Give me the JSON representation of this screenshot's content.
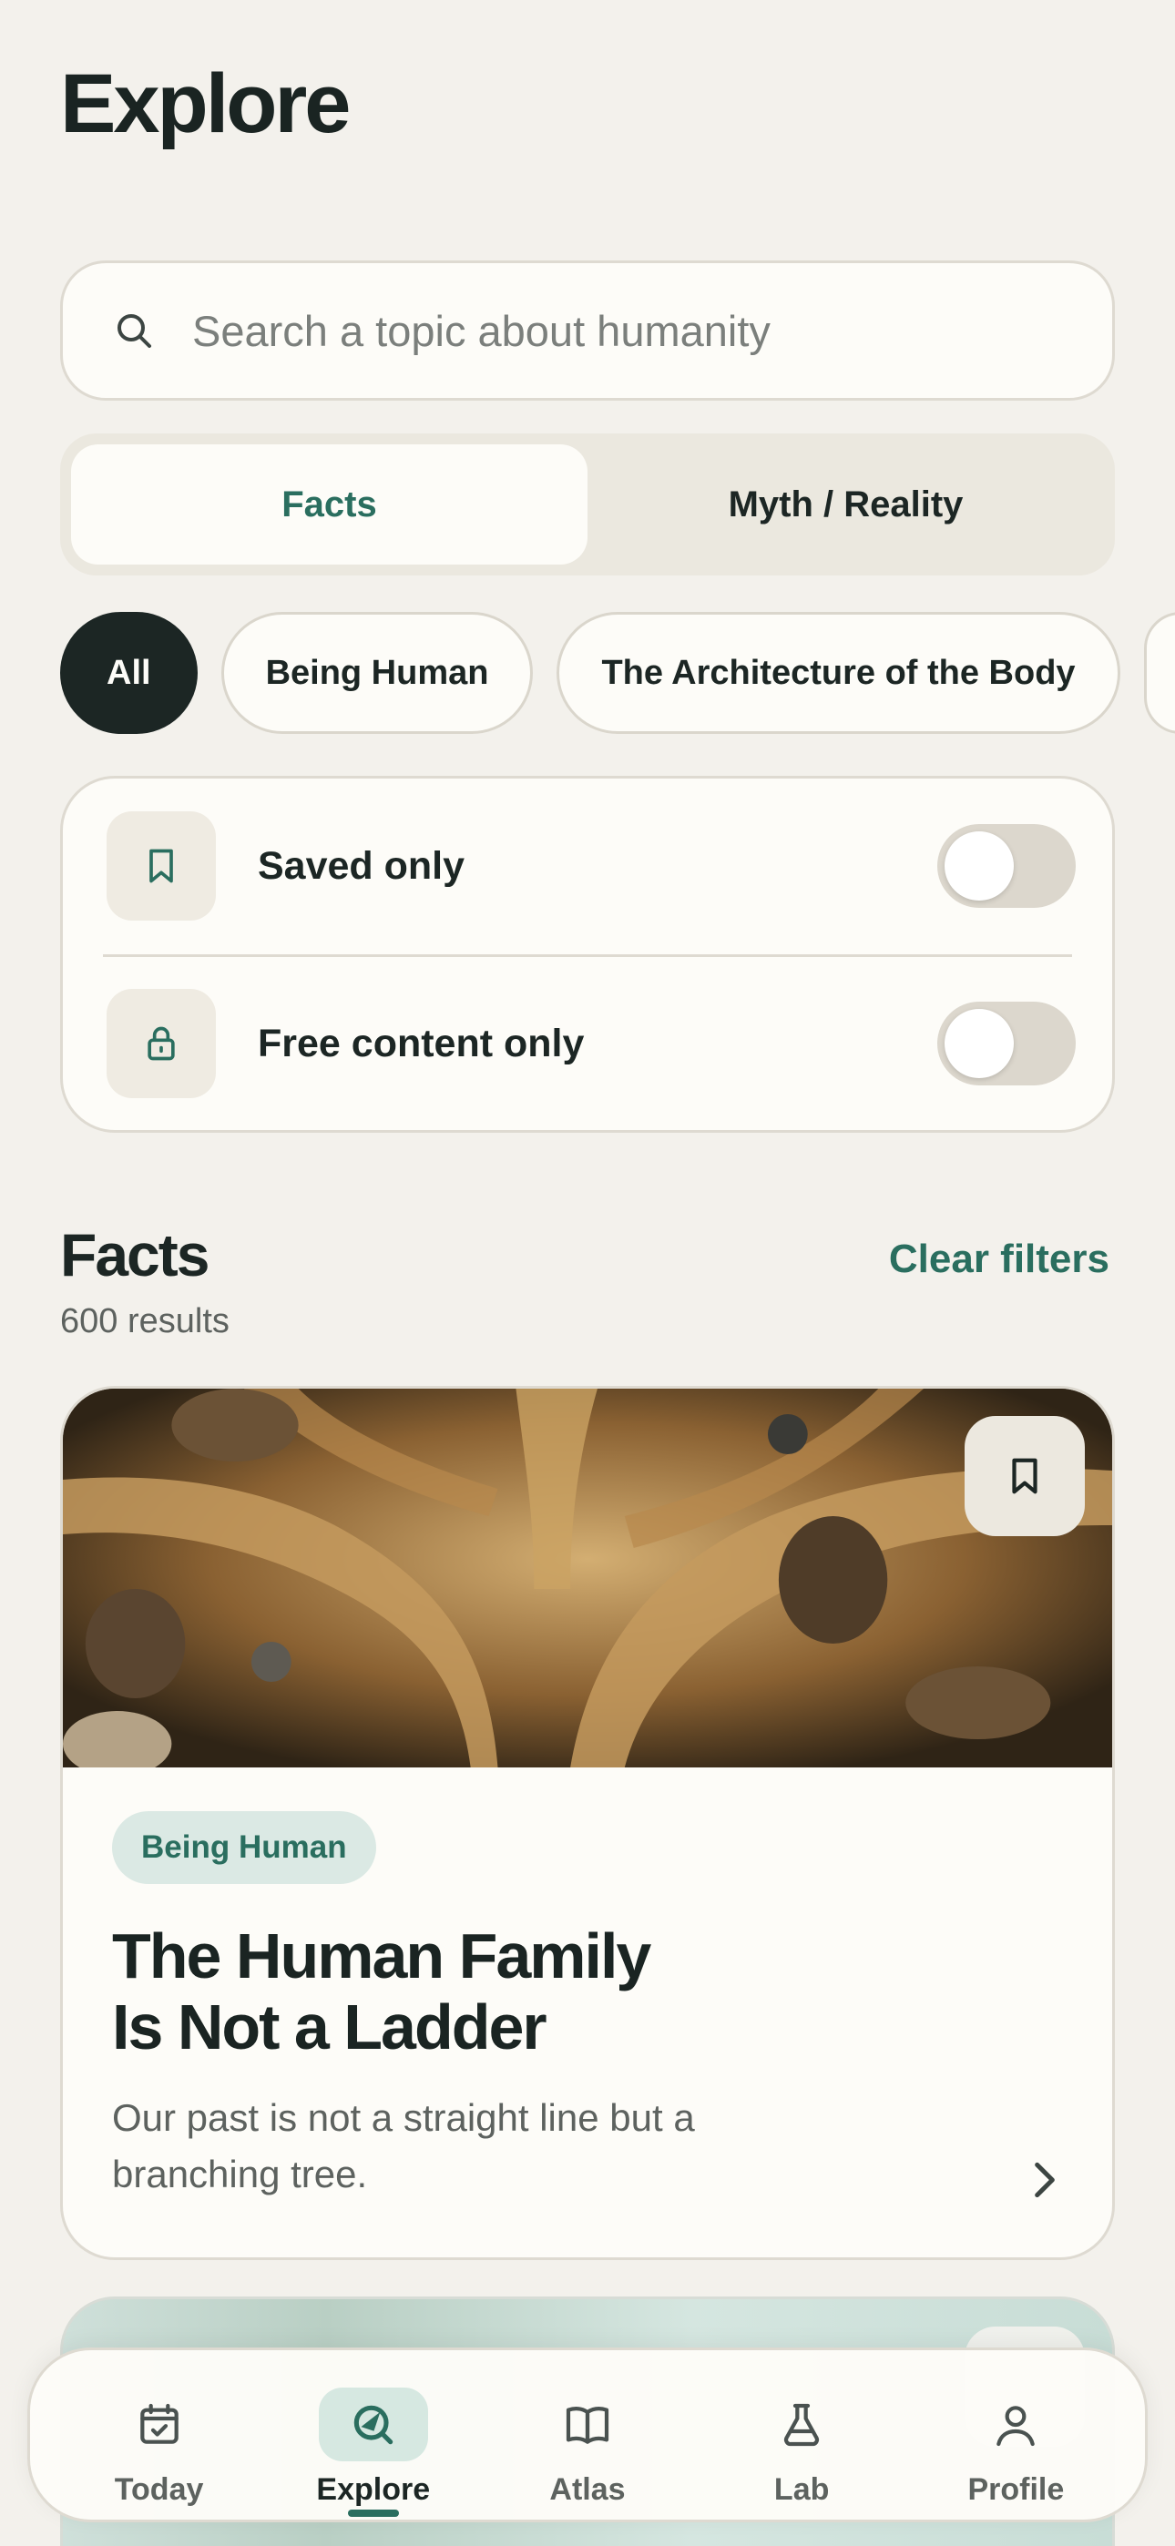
{
  "page": {
    "title": "Explore"
  },
  "search": {
    "placeholder": "Search a topic about humanity"
  },
  "segment": {
    "options": [
      "Facts",
      "Myth / Reality"
    ],
    "selected": "Facts"
  },
  "chips": {
    "items": [
      "All",
      "Being Human",
      "The Architecture of the Body"
    ],
    "selected": "All"
  },
  "filters": {
    "saved_only": {
      "label": "Saved only",
      "on": false
    },
    "free_only": {
      "label": "Free content only",
      "on": false
    }
  },
  "section": {
    "title": "Facts",
    "results": "600 results",
    "clear_label": "Clear filters"
  },
  "cards": [
    {
      "tag": "Being Human",
      "title_line1": "The Human Family",
      "title_line2": "Is Not a Ladder",
      "subtitle": "Our past is not a straight line but a branching tree."
    }
  ],
  "tabbar": {
    "items": [
      "Today",
      "Explore",
      "Atlas",
      "Lab",
      "Profile"
    ],
    "selected": "Explore"
  },
  "colors": {
    "accent": "#2a6e5f",
    "background": "#f3f1ec",
    "surface": "#fdfcf8",
    "dark": "#1c2624"
  }
}
